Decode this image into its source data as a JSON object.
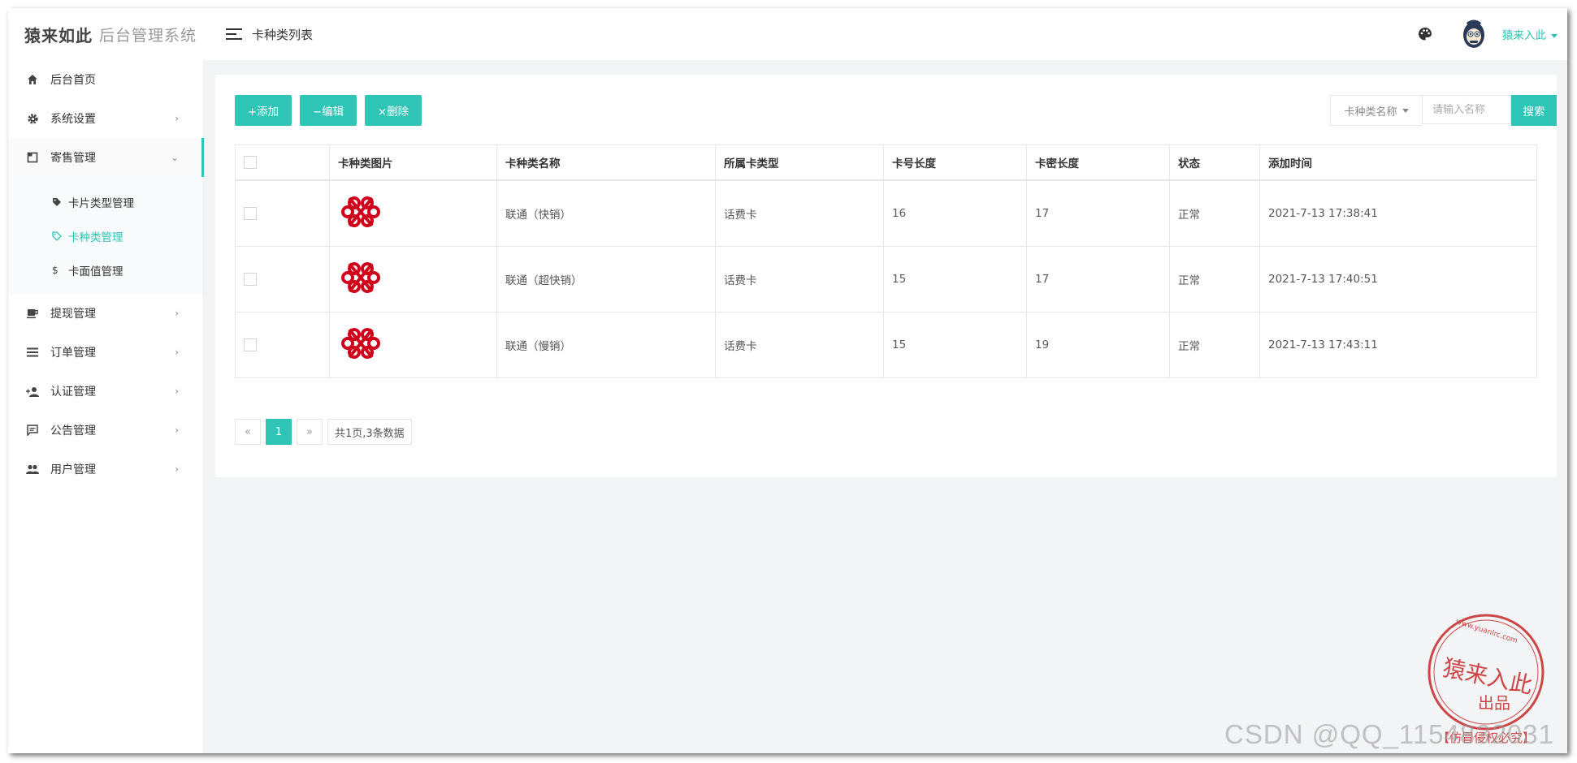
{
  "brand": {
    "logo_text": "猿来如此",
    "system_name": "后台管理系统"
  },
  "sidebar": {
    "items": [
      {
        "label": "后台首页",
        "icon": "home-icon"
      },
      {
        "label": "系统设置",
        "icon": "gear-icon",
        "arrow": "›"
      },
      {
        "label": "寄售管理",
        "icon": "square-icon",
        "arrow": "⌄",
        "open": true,
        "children": [
          {
            "label": "卡片类型管理",
            "icon": "tag-icon"
          },
          {
            "label": "卡种类管理",
            "icon": "tag-outline-icon",
            "active": true
          },
          {
            "label": "卡面值管理",
            "icon": "dollar-icon"
          }
        ]
      },
      {
        "label": "提现管理",
        "icon": "cup-icon",
        "arrow": "›"
      },
      {
        "label": "订单管理",
        "icon": "list-icon",
        "arrow": "›"
      },
      {
        "label": "认证管理",
        "icon": "user-add-icon",
        "arrow": "›"
      },
      {
        "label": "公告管理",
        "icon": "comment-icon",
        "arrow": "›"
      },
      {
        "label": "用户管理",
        "icon": "users-icon",
        "arrow": "›"
      }
    ]
  },
  "header": {
    "title": "卡种类列表",
    "user_name": "猿来入此"
  },
  "toolbar": {
    "add": "+添加",
    "edit": "−编辑",
    "delete": "×删除",
    "search_field": "卡种类名称",
    "search_placeholder": "请输入名称",
    "search_button": "搜索"
  },
  "table": {
    "headers": [
      "卡种类图片",
      "卡种类名称",
      "所属卡类型",
      "卡号长度",
      "卡密长度",
      "状态",
      "添加时间"
    ],
    "rows": [
      {
        "name": "联通（快销）",
        "type": "话费卡",
        "card_len": "16",
        "pwd_len": "17",
        "status": "正常",
        "time": "2021-7-13 17:38:41"
      },
      {
        "name": "联通（超快销）",
        "type": "话费卡",
        "card_len": "15",
        "pwd_len": "17",
        "status": "正常",
        "time": "2021-7-13 17:40:51"
      },
      {
        "name": "联通（慢销）",
        "type": "话费卡",
        "card_len": "15",
        "pwd_len": "19",
        "status": "正常",
        "time": "2021-7-13 17:43:11"
      }
    ]
  },
  "pagination": {
    "prev": "«",
    "current": "1",
    "next": "»",
    "info": "共1页,3条数据"
  },
  "watermark": {
    "seal_text": "猿来入此",
    "seal_sub": "出品",
    "seal_url": "www.yuanlrc.com",
    "seal_bottom": "【仿冒侵权必究】",
    "csdn": "CSDN @QQ_1154832031"
  },
  "colors": {
    "accent": "#2ec4b6",
    "logo_red": "#d0021b"
  }
}
